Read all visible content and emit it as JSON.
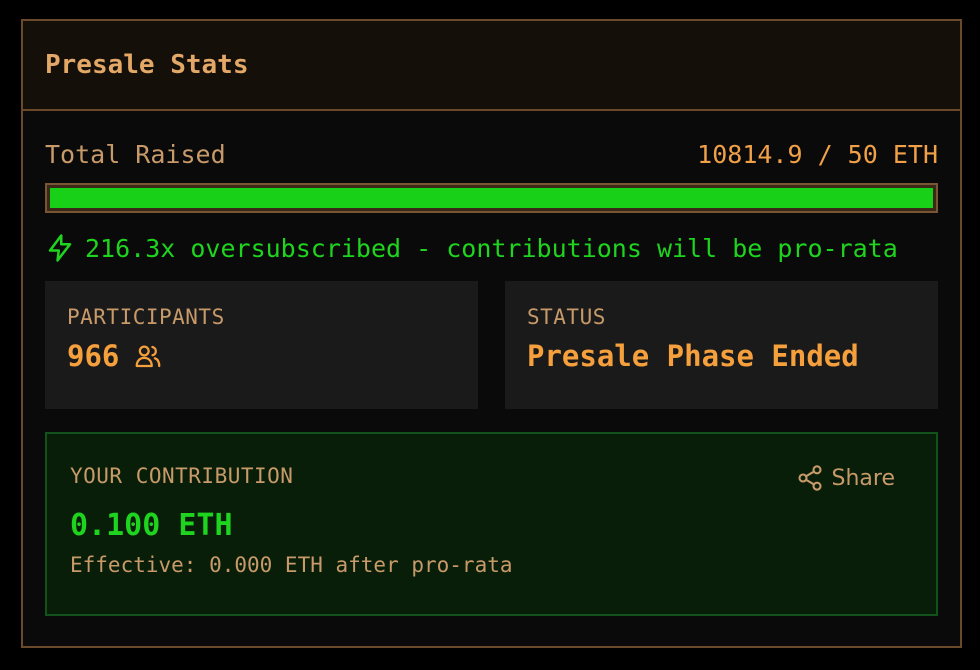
{
  "header": {
    "title": "Presale Stats"
  },
  "raised": {
    "label": "Total Raised",
    "value": "10814.9 / 50 ETH",
    "progress_fraction": 1.0
  },
  "oversubscription": {
    "icon": "lightning-bolt-icon",
    "text": "216.3x oversubscribed - contributions will be pro-rata"
  },
  "stats": {
    "participants": {
      "label": "PARTICIPANTS",
      "value": "966",
      "icon": "users-icon"
    },
    "status": {
      "label": "STATUS",
      "value": "Presale Phase Ended"
    }
  },
  "contribution": {
    "label": "YOUR CONTRIBUTION",
    "share_label": "Share",
    "share_icon": "share-icon",
    "value": "0.100 ETH",
    "effective": "Effective: 0.000 ETH after pro-rata"
  },
  "colors": {
    "accent_orange": "#f5a03c",
    "label_tan": "#c89a6a",
    "success_green": "#1ed41e",
    "border_brown": "#6b4a2b",
    "contribution_bg": "#081e08"
  }
}
